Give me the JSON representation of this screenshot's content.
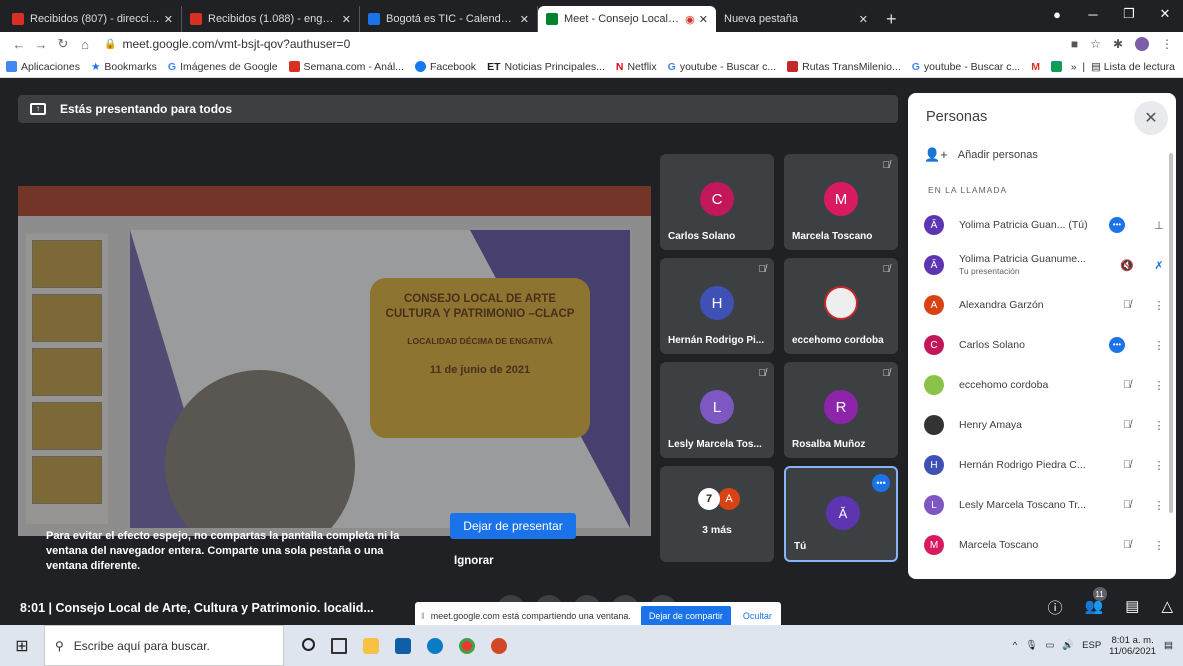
{
  "tabs": [
    {
      "label": "Recibidos (807) - direccion.asunt",
      "color": "#d93025"
    },
    {
      "label": "Recibidos (1.088) - engativa@scr",
      "color": "#d93025"
    },
    {
      "label": "Bogotá es TIC - Calendar - vierne",
      "color": "#1a73e8"
    },
    {
      "label": "Meet - Consejo Local de Arte",
      "color": "#00832d",
      "active": true
    },
    {
      "label": "Nueva pestaña",
      "color": "#202124"
    }
  ],
  "address": {
    "url": "meet.google.com/vmt-bsjt-qov?authuser=0"
  },
  "bookmarks": [
    {
      "label": "Aplicaciones",
      "color": "#4285f4"
    },
    {
      "label": "Bookmarks",
      "color": "#1a73e8"
    },
    {
      "label": "Imágenes de Google",
      "color": "#4285f4"
    },
    {
      "label": "Semana.com - Anál...",
      "color": "#d93025"
    },
    {
      "label": "Facebook",
      "color": "#1877f2"
    },
    {
      "label": "Noticias Principales...",
      "color": "#222"
    },
    {
      "label": "Netflix",
      "color": "#e50914"
    },
    {
      "label": "youtube - Buscar c...",
      "color": "#4285f4"
    },
    {
      "label": "Rutas TransMilenio...",
      "color": "#c62828"
    },
    {
      "label": "youtube - Buscar c...",
      "color": "#4285f4"
    }
  ],
  "reading_list": "Lista de lectura",
  "presenting_bar": "Estás presentando para todos",
  "slide": {
    "title": "CONSEJO  LOCAL DE ARTE CULTURA Y PATRIMONIO –CLACP",
    "subtitle": "LOCALIDAD DÉCIMA DE ENGATIVÁ",
    "date": "11 de junio de 2021"
  },
  "warning": "Para evitar el efecto espejo, no compartas la pantalla completa ni la ventana del navegador entera. Comparte una sola pestaña o una ventana diferente.",
  "stop_present_label": "Dejar de presentar",
  "ignore_label": "Ignorar",
  "tiles": [
    {
      "initial": "C",
      "name": "Carlos Solano",
      "color": "#c2185b",
      "muted": false
    },
    {
      "initial": "M",
      "name": "Marcela Toscano",
      "color": "#d81b60",
      "muted": true
    },
    {
      "initial": "H",
      "name": "Hernán Rodrigo Pi...",
      "color": "#3f51b5",
      "muted": true
    },
    {
      "initial": "",
      "name": "eccehomo cordoba",
      "color": "#fff",
      "muted": true
    },
    {
      "initial": "L",
      "name": "Lesly Marcela Tos...",
      "color": "#7e57c2",
      "muted": true
    },
    {
      "initial": "R",
      "name": "Rosalba Muñoz",
      "color": "#8e24aa",
      "muted": true
    }
  ],
  "more_tile": {
    "label": "3 más",
    "initial": "A"
  },
  "me_tile": {
    "label": "Tú"
  },
  "panel": {
    "title": "Personas",
    "add_label": "Añadir personas",
    "section": "EN LA LLAMADA",
    "people": [
      {
        "name": "Yolima Patricia Guan...  (Tú)",
        "initial": "",
        "color": "#5e35b1"
      },
      {
        "name": "Yolima Patricia Guanume...",
        "sub": "Tu presentación",
        "initial": "",
        "color": "#5e35b1"
      },
      {
        "name": "Alexandra Garzón",
        "initial": "A",
        "color": "#d84315"
      },
      {
        "name": "Carlos Solano",
        "initial": "C",
        "color": "#c2185b"
      },
      {
        "name": "eccehomo cordoba",
        "initial": "",
        "color": "#8bc34a"
      },
      {
        "name": "Henry Amaya",
        "initial": "",
        "color": "#333"
      },
      {
        "name": "Hernán Rodrigo Piedra C...",
        "initial": "H",
        "color": "#3f51b5"
      },
      {
        "name": "Lesly Marcela Toscano Tr...",
        "initial": "L",
        "color": "#7e57c2"
      },
      {
        "name": "Marcela Toscano",
        "initial": "M",
        "color": "#d81b60"
      }
    ]
  },
  "meeting_info": "8:01  |  Consejo Local de Arte, Cultura y Patrimonio. localid...",
  "participant_count": "11",
  "share_note": {
    "text": "meet.google.com está compartiendo una ventana.",
    "stop": "Dejar de compartir",
    "hide": "Ocultar"
  },
  "taskbar": {
    "search": "Escribe aquí para buscar.",
    "lang": "ESP",
    "time": "8:01 a. m.",
    "date": "11/06/2021"
  }
}
